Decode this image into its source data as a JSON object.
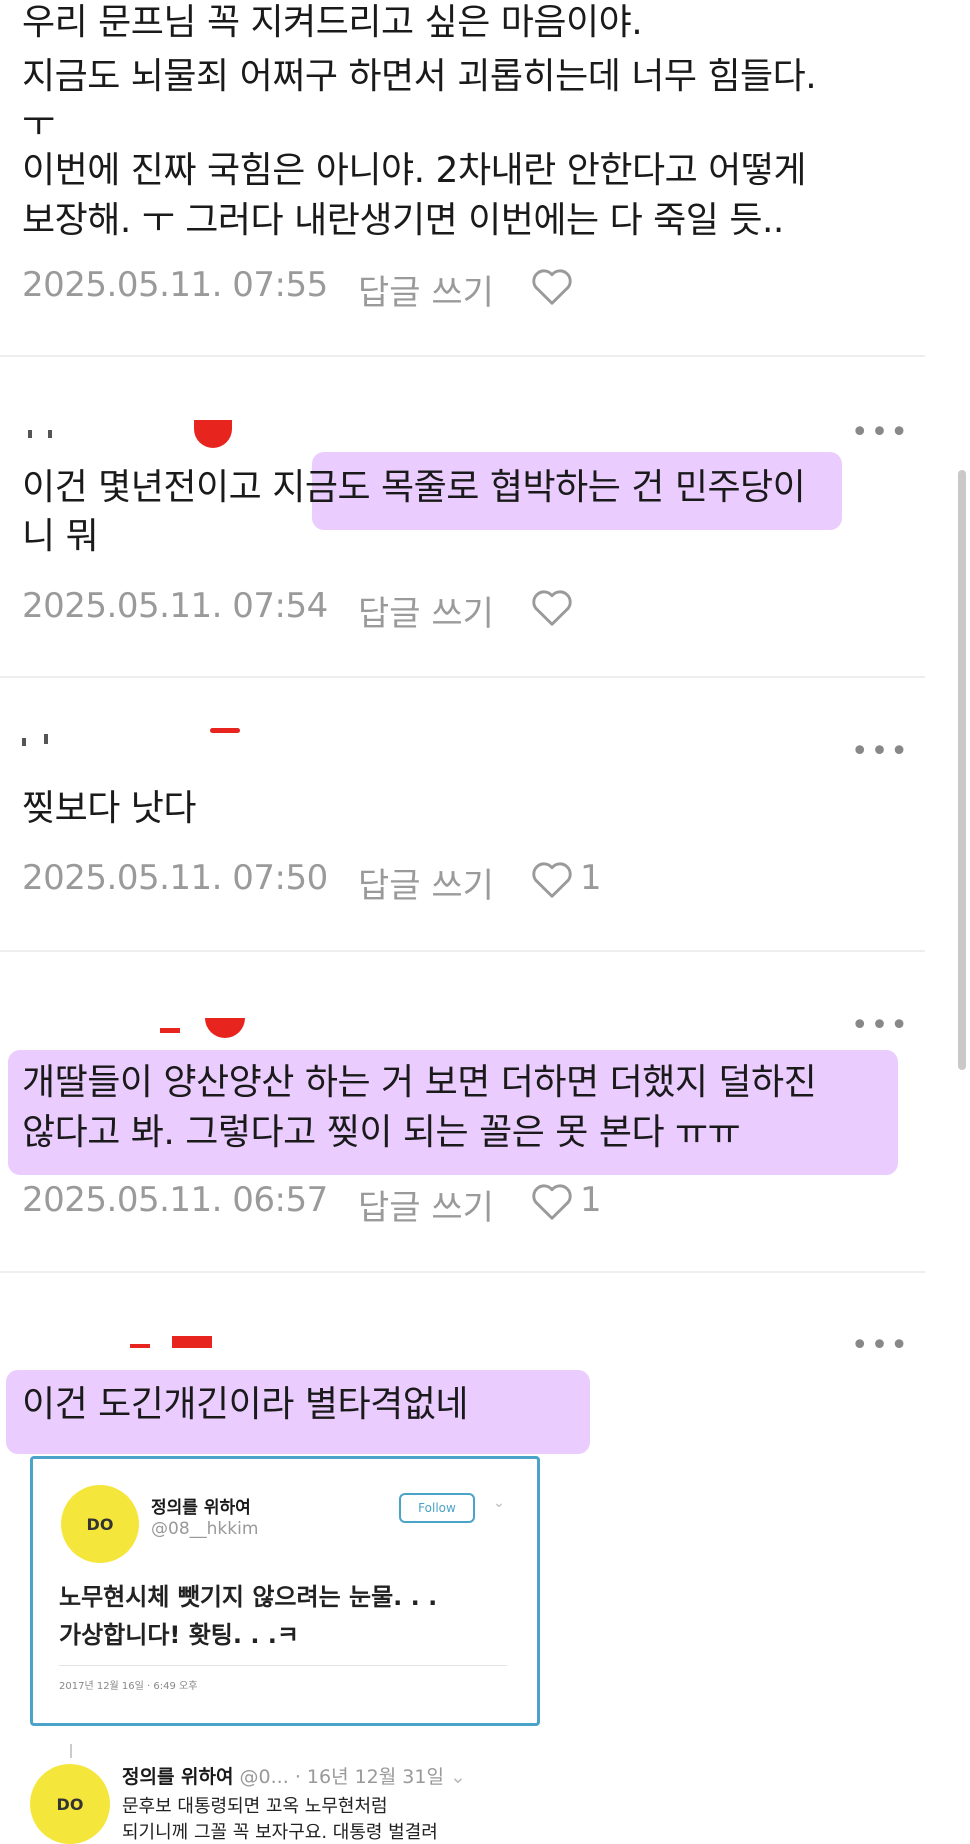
{
  "comments": [
    {
      "lines": [
        "우리 문프님 꼭 지켜드리고 싶은 마음이야.",
        "지금도 뇌물죄 어쩌구 하면서 괴롭히는데 너무 힘들다.",
        "ㅜ",
        "이번에 진짜 국힘은 아니야. 2차내란 안한다고 어떻게",
        "보장해. ㅜ 그러다 내란생기면 이번에는 다 죽일 듯.."
      ],
      "date": "2025.05.11. 07:55",
      "reply": "답글 쓰기",
      "likes": ""
    },
    {
      "lines": [
        "이건 몇년전이고 지금도 목줄로 협박하는 건 민주당이",
        "니 뭐"
      ],
      "date": "2025.05.11. 07:54",
      "reply": "답글 쓰기",
      "likes": ""
    },
    {
      "lines": [
        "찢보다 낫다"
      ],
      "date": "2025.05.11. 07:50",
      "reply": "답글 쓰기",
      "likes": "1"
    },
    {
      "lines": [
        "개딸들이 양산양산 하는 거 보면 더하면 더했지 덜하진",
        "않다고 봐. 그렇다고 찢이 되는 꼴은 못 본다 ㅠㅠ"
      ],
      "date": "2025.05.11. 06:57",
      "reply": "답글 쓰기",
      "likes": "1"
    },
    {
      "lines": [
        "이건 도긴개긴이라 별타격없네"
      ]
    }
  ],
  "more_label": "•••",
  "tweet1": {
    "name": "정의를 위하여",
    "handle": "@08__hkkim",
    "follow": "Follow",
    "body1": "노무현시체 뺏기지 않으려는 눈물. . .",
    "body2": "가상합니다! 홧팅. . .ㅋ",
    "time": "2017년 12월 16일 · 6:49 오후",
    "avatar": "DO"
  },
  "tweet2": {
    "name": "정의를 위하여",
    "handle": "@0...",
    "date": "· 16년 12월 31일",
    "body": "문후보 대통령되면 꼬옥 노무현처럼",
    "body2": "되기니께 그꼴 꼭 보자구요. 대통령 벌결려",
    "avatar": "DO"
  },
  "colors": {
    "highlight": "#e8c6ff",
    "meta": "#9a9a9a",
    "tweet_border": "#4aa3c8",
    "avatar": "#f5e63b"
  }
}
